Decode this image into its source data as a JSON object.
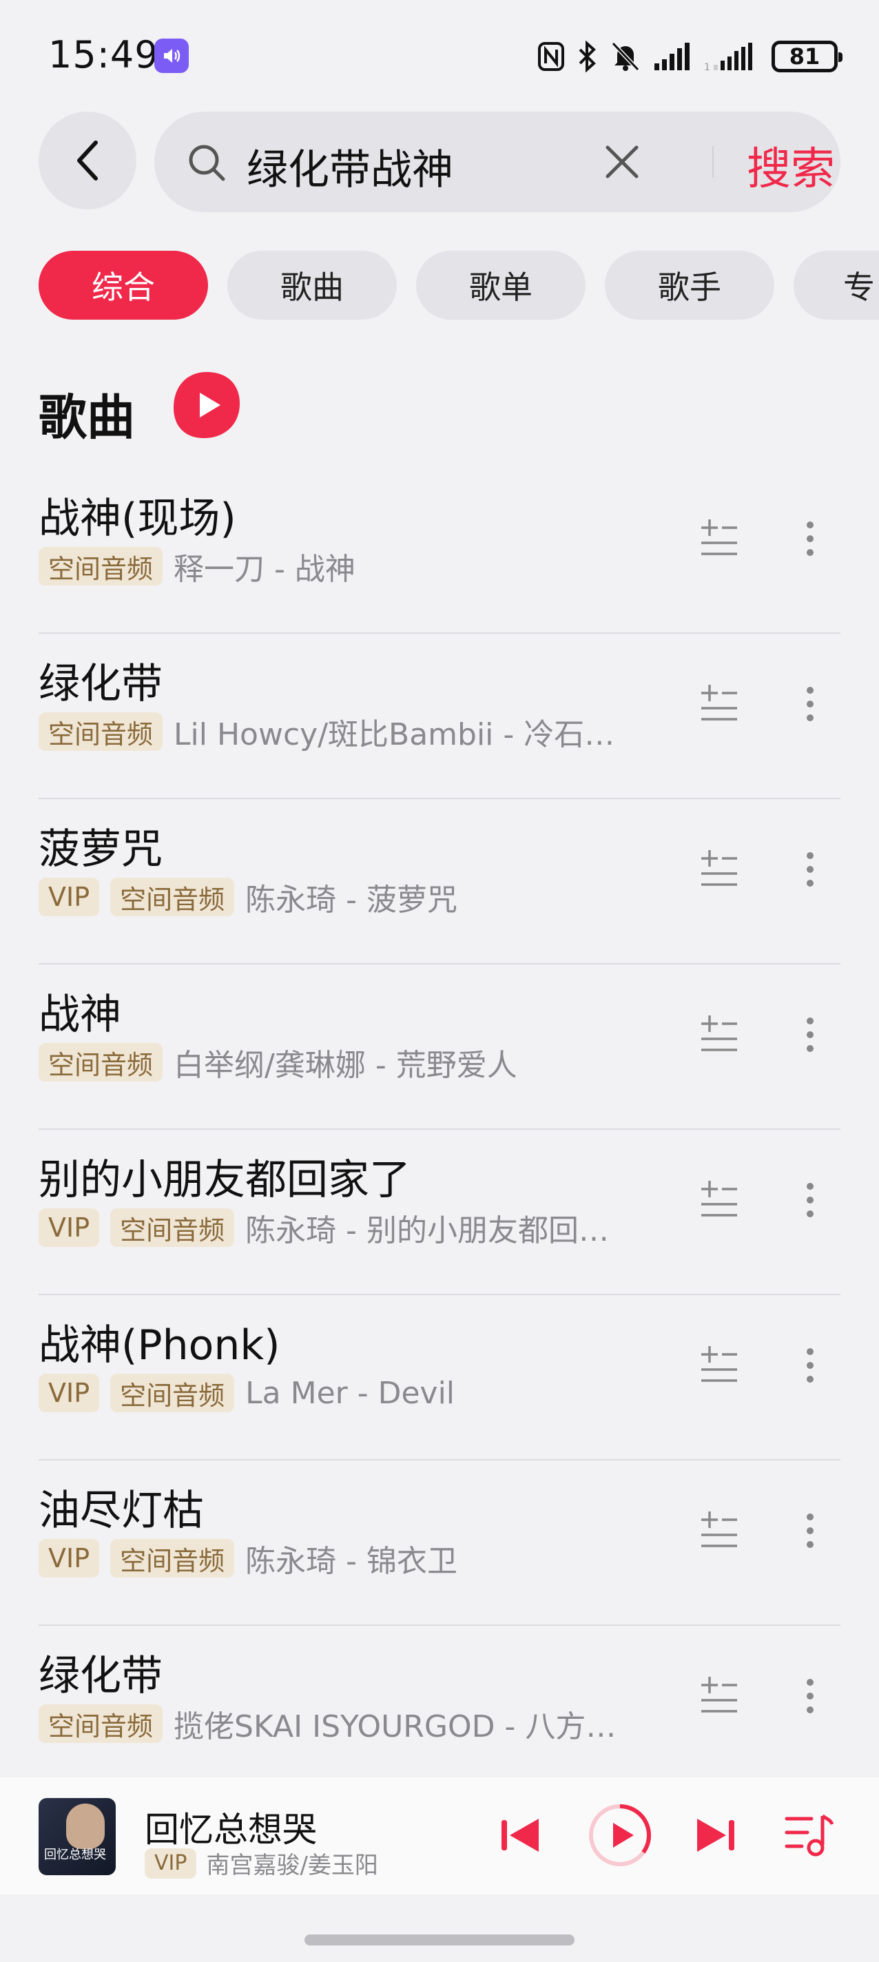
{
  "status_bar": {
    "time": "15:49",
    "battery": "81"
  },
  "search": {
    "query": "绿化带战神",
    "button_label": "搜索"
  },
  "tabs": [
    "综合",
    "歌曲",
    "歌单",
    "歌手",
    "专"
  ],
  "section": {
    "title": "歌曲"
  },
  "songs": [
    {
      "title": "战神(现场)",
      "tags": [
        "空间音频"
      ],
      "artist_album": "释一刀 - 战神"
    },
    {
      "title": "绿化带",
      "tags": [
        "空间音频"
      ],
      "artist_album": "Lil Howcy/斑比Bambii - 冷石…"
    },
    {
      "title": "菠萝咒",
      "tags": [
        "VIP",
        "空间音频"
      ],
      "artist_album": "陈永琦 - 菠萝咒"
    },
    {
      "title": "战神",
      "tags": [
        "空间音频"
      ],
      "artist_album": "白举纲/龚琳娜 - 荒野爱人"
    },
    {
      "title": "别的小朋友都回家了",
      "tags": [
        "VIP",
        "空间音频"
      ],
      "artist_album": "陈永琦 - 别的小朋友都回…"
    },
    {
      "title": "战神(Phonk)",
      "tags": [
        "VIP",
        "空间音频"
      ],
      "artist_album": "La Mer - Devil"
    },
    {
      "title": "油尽灯枯",
      "tags": [
        "VIP",
        "空间音频"
      ],
      "artist_album": "陈永琦 - 锦衣卫"
    },
    {
      "title": "绿化带",
      "tags": [
        "空间音频"
      ],
      "artist_album": "揽佬SKAI ISYOURGOD - 八方…"
    }
  ],
  "player": {
    "title": "回忆总想哭",
    "tag": "VIP",
    "artist": "南宫嘉骏/姜玉阳",
    "cover_text": "回忆总想哭",
    "progress": 0.35
  },
  "colors": {
    "accent": "#f0284a",
    "tag_bg": "#f0e6d6",
    "tag_text": "#8a6a3a"
  }
}
